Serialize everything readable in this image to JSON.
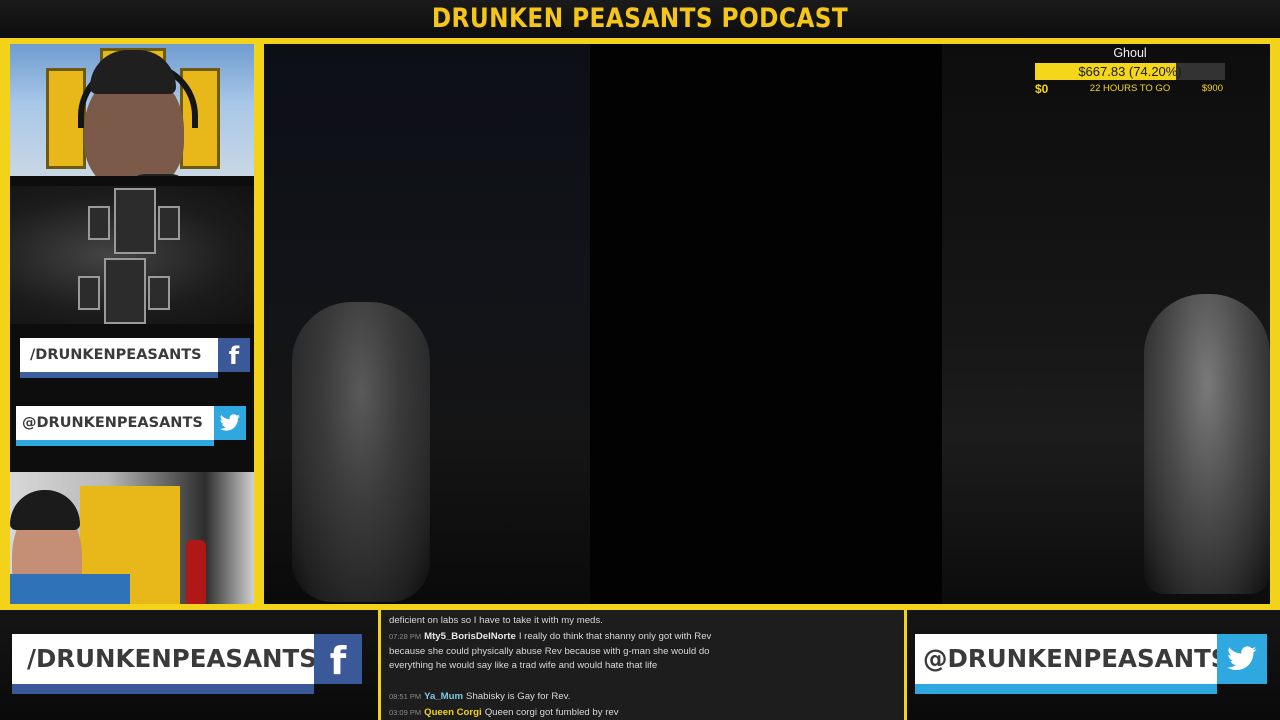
{
  "header": {
    "title": "DRUNKEN PEASANTS PODCAST"
  },
  "colors": {
    "accent": "#f2d31a",
    "facebook": "#3b5998",
    "twitter": "#2fa8df"
  },
  "social": {
    "facebook_handle": "/DRUNKENPEASANTS",
    "facebook_icon": "facebook-icon",
    "twitter_handle": "@DRUNKENPEASANTS",
    "twitter_icon": "twitter-icon"
  },
  "goal": {
    "name": "Ghoul",
    "amount_text": "$667.83 (74.20%)",
    "progress": 0.742,
    "start": "$0",
    "time_left": "22 HOURS TO GO",
    "target": "$900"
  },
  "chat": {
    "messages": [
      {
        "time": "",
        "user": "",
        "text": "deficient on labs so I have to take it with my meds.",
        "user_color": "#d8d8d8"
      },
      {
        "time": "07:28 PM",
        "user": "Mty5_BorisDelNorte",
        "text": "I really do think that shanny only got with Rev because she could physically abuse Rev because with g-man she would do everything he would say like a trad wife and would hate that life",
        "user_color": "#e8e8e8"
      },
      {
        "time": "08:51 PM",
        "user": "Ya_Mum",
        "text": "Shabisky is Gay for Rev.",
        "user_color": "#7ec8e3"
      },
      {
        "time": "03:09 PM",
        "user": "Queen Corgi",
        "text": "Queen corgi got fumbled by rev",
        "user_color": "#f2d31a"
      }
    ]
  }
}
